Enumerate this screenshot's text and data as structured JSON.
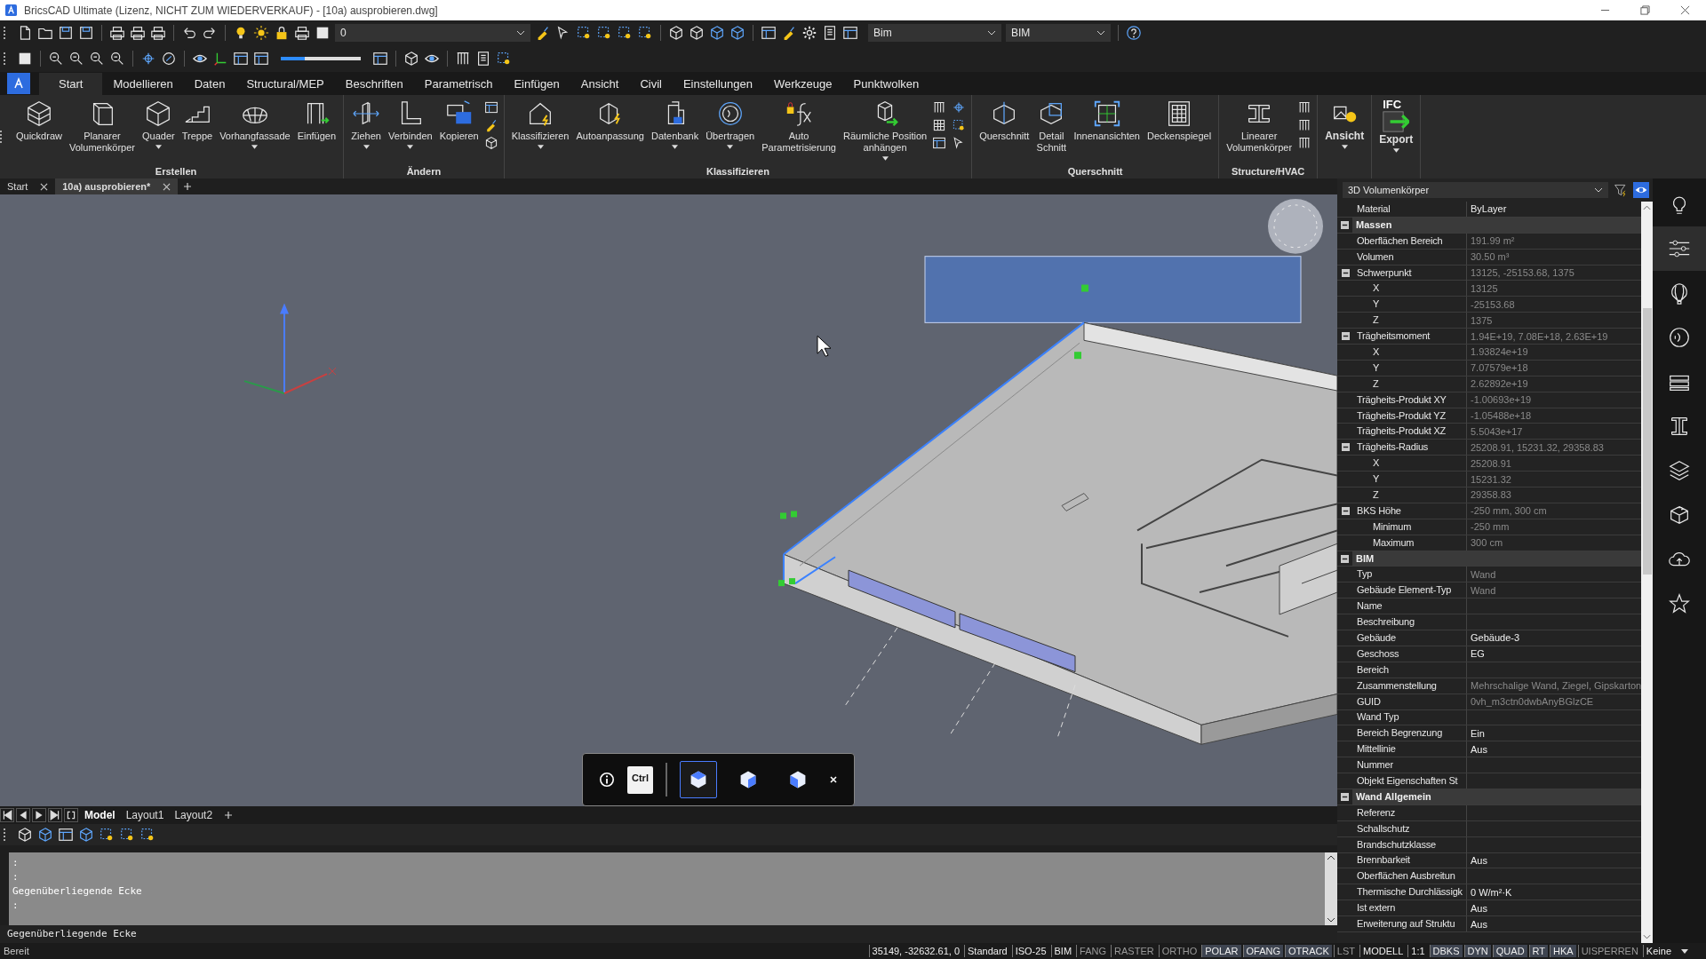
{
  "window": {
    "title": "BricsCAD Ultimate (Lizenz, NICHT ZUM WIEDERVERKAUF) - [10a) ausprobieren.dwg]"
  },
  "quick_toolbar": {
    "layer": "0",
    "workspace": "Bim",
    "profile": "BIM",
    "slider": {
      "level": 0.3
    }
  },
  "ribbon": {
    "tabs": [
      {
        "label": "Start",
        "selected": true
      },
      {
        "label": "Modellieren",
        "selected": false
      },
      {
        "label": "Daten",
        "selected": false
      },
      {
        "label": "Structural/MEP",
        "selected": false
      },
      {
        "label": "Beschriften",
        "selected": false
      },
      {
        "label": "Parametrisch",
        "selected": false
      },
      {
        "label": "Einfügen",
        "selected": false
      },
      {
        "label": "Ansicht",
        "selected": false
      },
      {
        "label": "Civil",
        "selected": false
      },
      {
        "label": "Einstellungen",
        "selected": false
      },
      {
        "label": "Werkzeuge",
        "selected": false
      },
      {
        "label": "Punktwolken",
        "selected": false
      }
    ],
    "groups": [
      {
        "kind": "titled",
        "title": "Erstellen",
        "buttons": [
          {
            "label": "Quickdraw",
            "dropdown": false
          },
          {
            "label": "Planarer\nVolumenkörper",
            "dropdown": false
          },
          {
            "label": "Quader",
            "dropdown": true
          },
          {
            "label": "Treppe",
            "dropdown": false
          },
          {
            "label": "Vorhangfassade",
            "dropdown": true
          },
          {
            "label": "Einfügen",
            "dropdown": false
          }
        ]
      },
      {
        "kind": "titled",
        "title": "Ändern",
        "buttons": [
          {
            "label": "Ziehen",
            "dropdown": true
          },
          {
            "label": "Verbinden",
            "dropdown": true
          },
          {
            "label": "Kopieren",
            "dropdown": false
          }
        ]
      },
      {
        "kind": "titled",
        "title": "Klassifizieren",
        "buttons": [
          {
            "label": "Klassifizieren",
            "dropdown": true
          },
          {
            "label": "Autoanpassung",
            "dropdown": false
          },
          {
            "label": "Datenbank",
            "dropdown": true
          },
          {
            "label": "Übertragen",
            "dropdown": true
          },
          {
            "label": "Auto\nParametrisierung",
            "dropdown": false
          },
          {
            "label": "Räumliche Position\nanhängen",
            "dropdown": true
          }
        ]
      },
      {
        "kind": "titled",
        "title": "Querschnitt",
        "buttons": [
          {
            "label": "Querschnitt",
            "dropdown": false
          },
          {
            "label": "Detail\nSchnitt",
            "dropdown": false
          },
          {
            "label": "Innenansichten",
            "dropdown": false
          },
          {
            "label": "Deckenspiegel",
            "dropdown": false
          }
        ]
      },
      {
        "kind": "titled",
        "title": "Structure/HVAC",
        "buttons": [
          {
            "label": "Linearer\nVolumenkörper",
            "dropdown": false
          }
        ]
      },
      {
        "kind": "plain",
        "buttons": [
          {
            "label": "Ansicht",
            "dropdown": true
          }
        ]
      },
      {
        "kind": "plain",
        "buttons": [
          {
            "label": "Export",
            "dropdown": true,
            "icon_text": "IFC"
          }
        ]
      }
    ]
  },
  "document_tabs": [
    {
      "label": "Start",
      "selected": false
    },
    {
      "label": "10a) ausprobieren*",
      "selected": true
    }
  ],
  "viewport": {
    "quad_toolbar": {
      "key": "Ctrl",
      "modes": [
        {
          "selected": true
        },
        {
          "selected": false
        },
        {
          "selected": false
        }
      ]
    }
  },
  "layout_tabs": [
    {
      "label": "Model",
      "selected": true
    },
    {
      "label": "Layout1",
      "selected": false
    },
    {
      "label": "Layout2",
      "selected": false
    }
  ],
  "command_line": {
    "history": [
      ":",
      ":",
      "Gegenüberliegende Ecke",
      ":"
    ],
    "prompt": "Gegenüberliegende Ecke"
  },
  "properties": {
    "object_type": "3D Volumenkörper",
    "material": {
      "name": "Material",
      "value": "ByLayer"
    },
    "categories": [
      {
        "label": "Massen",
        "expanded": true,
        "rows": [
          {
            "name": "Oberflächen Bereich",
            "value": "191.99 m²",
            "readonly": true
          },
          {
            "name": "Volumen",
            "value": "30.50 m³",
            "readonly": true
          },
          {
            "name": "Schwerpunkt",
            "value": "13125, -25153.68, 1375",
            "readonly": true,
            "expanded": true,
            "children": [
              {
                "name": "X",
                "value": "13125",
                "readonly": true
              },
              {
                "name": "Y",
                "value": "-25153.68",
                "readonly": true
              },
              {
                "name": "Z",
                "value": "1375",
                "readonly": true
              }
            ]
          },
          {
            "name": "Trägheitsmoment",
            "value": "1.94E+19, 7.08E+18, 2.63E+19",
            "readonly": true,
            "expanded": true,
            "children": [
              {
                "name": "X",
                "value": "1.93824e+19",
                "readonly": true
              },
              {
                "name": "Y",
                "value": "7.07579e+18",
                "readonly": true
              },
              {
                "name": "Z",
                "value": "2.62892e+19",
                "readonly": true
              }
            ]
          },
          {
            "name": "Trägheits-Produkt XY",
            "value": "-1.00693e+19",
            "readonly": true
          },
          {
            "name": "Trägheits-Produkt YZ",
            "value": "-1.05488e+18",
            "readonly": true
          },
          {
            "name": "Trägheits-Produkt XZ",
            "value": "5.5043e+17",
            "readonly": true
          },
          {
            "name": "Trägheits-Radius",
            "value": "25208.91, 15231.32, 29358.83",
            "readonly": true,
            "expanded": true,
            "children": [
              {
                "name": "X",
                "value": "25208.91",
                "readonly": true
              },
              {
                "name": "Y",
                "value": "15231.32",
                "readonly": true
              },
              {
                "name": "Z",
                "value": "29358.83",
                "readonly": true
              }
            ]
          },
          {
            "name": "BKS Höhe",
            "value": "-250 mm, 300 cm",
            "readonly": true,
            "expanded": true,
            "children": [
              {
                "name": "Minimum",
                "value": "-250 mm",
                "readonly": true
              },
              {
                "name": "Maximum",
                "value": "300 cm",
                "readonly": true
              }
            ]
          }
        ]
      },
      {
        "label": "BIM",
        "expanded": true,
        "rows": [
          {
            "name": "Typ",
            "value": "Wand",
            "readonly": true
          },
          {
            "name": "Gebäude Element-Typ",
            "value": "Wand",
            "readonly": true
          },
          {
            "name": "Name"
          },
          {
            "name": "Beschreibung"
          },
          {
            "name": "Gebäude",
            "value": "Gebäude-3",
            "readonly": false
          },
          {
            "name": "Geschoss",
            "value": "EG",
            "readonly": false
          },
          {
            "name": "Bereich"
          },
          {
            "name": "Zusammenstellung",
            "value": "Mehrschalige Wand, Ziegel, Gipskarton",
            "readonly": true
          },
          {
            "name": "GUID",
            "value": "0vh_m3ctn0dwbAnyBGlzCE",
            "readonly": true
          },
          {
            "name": "Wand Typ"
          },
          {
            "name": "Bereich Begrenzung",
            "value": "Ein",
            "readonly": false
          },
          {
            "name": "Mittellinie",
            "value": "Aus",
            "readonly": false
          },
          {
            "name": "Nummer"
          },
          {
            "name": "Objekt Eigenschaften St"
          }
        ]
      },
      {
        "label": "Wand Allgemein",
        "expanded": true,
        "rows": [
          {
            "name": "Referenz"
          },
          {
            "name": "Schallschutz"
          },
          {
            "name": "Brandschutzklasse"
          },
          {
            "name": "Brennbarkeit",
            "value": "Aus",
            "readonly": false
          },
          {
            "name": "Oberflächen Ausbreitun"
          },
          {
            "name": "Thermische Durchlässigk",
            "value": "0 W/m²·K",
            "readonly": false
          },
          {
            "name": "Ist extern",
            "value": "Aus",
            "readonly": false
          },
          {
            "name": "Erweiterung auf Struktu",
            "value": "Aus",
            "readonly": false
          }
        ]
      }
    ]
  },
  "status_bar": {
    "message": "Bereit",
    "items": [
      {
        "kind": "text",
        "label": "35149, -32632.61, 0"
      },
      {
        "kind": "text",
        "label": "Standard"
      },
      {
        "kind": "text",
        "label": "ISO-25"
      },
      {
        "kind": "text",
        "label": "BIM"
      },
      {
        "kind": "toggle",
        "label": "FANG",
        "on": false
      },
      {
        "kind": "toggle",
        "label": "RASTER",
        "on": false
      },
      {
        "kind": "toggle",
        "label": "ORTHO",
        "on": false
      },
      {
        "kind": "toggle",
        "label": "POLAR",
        "on": true
      },
      {
        "kind": "toggle",
        "label": "OFANG",
        "on": true
      },
      {
        "kind": "toggle",
        "label": "OTRACK",
        "on": true
      },
      {
        "kind": "toggle",
        "label": "LST",
        "on": false
      },
      {
        "kind": "text",
        "label": "MODELL"
      },
      {
        "kind": "text",
        "label": "1:1"
      },
      {
        "kind": "toggle",
        "label": "DBKS",
        "on": true
      },
      {
        "kind": "toggle",
        "label": "DYN",
        "on": true
      },
      {
        "kind": "toggle",
        "label": "QUAD",
        "on": true
      },
      {
        "kind": "toggle",
        "label": "RT",
        "on": true
      },
      {
        "kind": "toggle",
        "label": "HKA",
        "on": true
      },
      {
        "kind": "toggle",
        "label": "UISPERREN",
        "on": false
      },
      {
        "kind": "text",
        "label": "Keine"
      }
    ]
  }
}
